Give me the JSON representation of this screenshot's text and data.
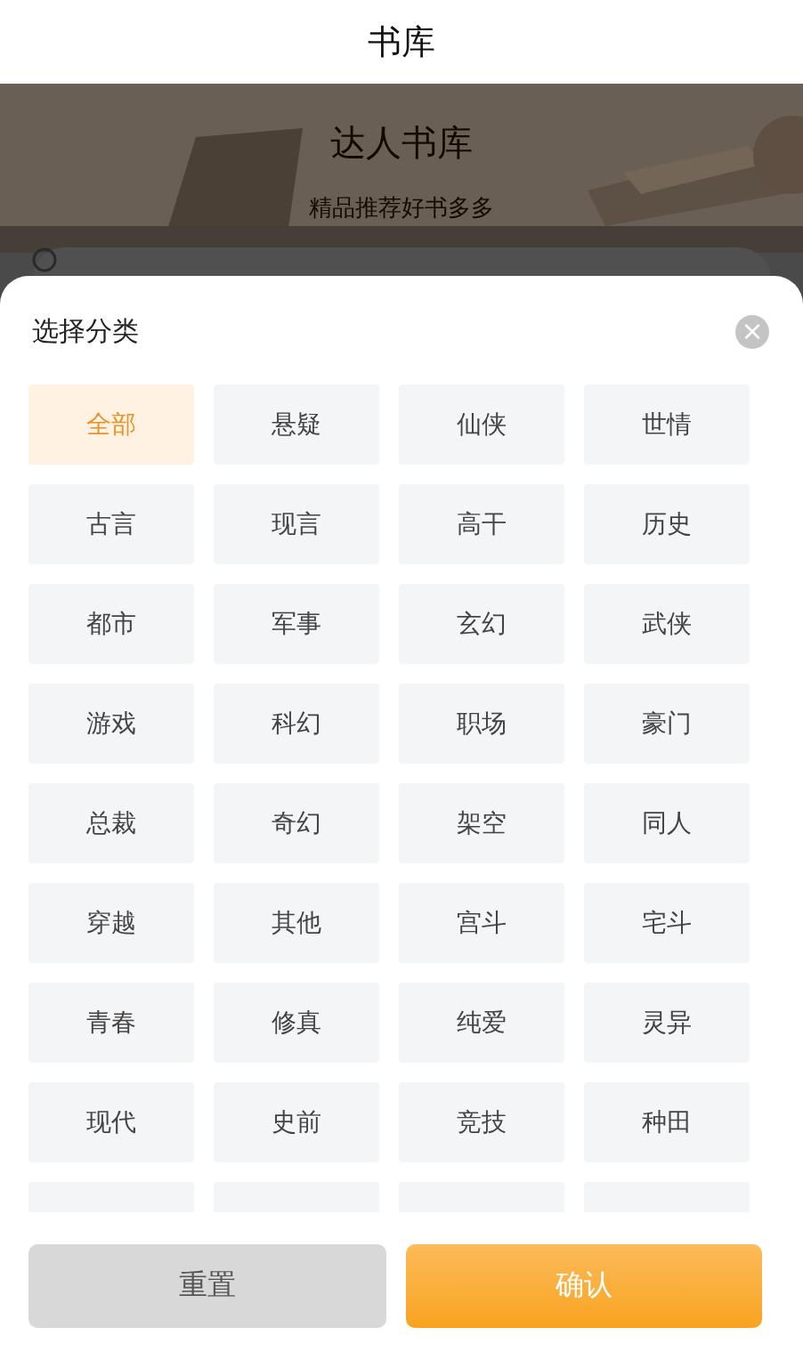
{
  "nav_bar": {
    "title": "书库"
  },
  "banner": {
    "title": "达人书库",
    "subtitle": "精品推荐好书多多"
  },
  "sheet": {
    "title": "选择分类",
    "close": "×",
    "categories": [
      {
        "label": "全部",
        "selected": true
      },
      {
        "label": "悬疑",
        "selected": false
      },
      {
        "label": "仙侠",
        "selected": false
      },
      {
        "label": "世情",
        "selected": false
      },
      {
        "label": "古言",
        "selected": false
      },
      {
        "label": "现言",
        "selected": false
      },
      {
        "label": "高干",
        "selected": false
      },
      {
        "label": "历史",
        "selected": false
      },
      {
        "label": "都市",
        "selected": false
      },
      {
        "label": "军事",
        "selected": false
      },
      {
        "label": "玄幻",
        "selected": false
      },
      {
        "label": "武侠",
        "selected": false
      },
      {
        "label": "游戏",
        "selected": false
      },
      {
        "label": "科幻",
        "selected": false
      },
      {
        "label": "职场",
        "selected": false
      },
      {
        "label": "豪门",
        "selected": false
      },
      {
        "label": "总裁",
        "selected": false
      },
      {
        "label": "奇幻",
        "selected": false
      },
      {
        "label": "架空",
        "selected": false
      },
      {
        "label": "同人",
        "selected": false
      },
      {
        "label": "穿越",
        "selected": false
      },
      {
        "label": "其他",
        "selected": false
      },
      {
        "label": "宫斗",
        "selected": false
      },
      {
        "label": "宅斗",
        "selected": false
      },
      {
        "label": "青春",
        "selected": false
      },
      {
        "label": "修真",
        "selected": false
      },
      {
        "label": "纯爱",
        "selected": false
      },
      {
        "label": "灵异",
        "selected": false
      },
      {
        "label": "现代",
        "selected": false
      },
      {
        "label": "史前",
        "selected": false
      },
      {
        "label": "竞技",
        "selected": false
      },
      {
        "label": "种田",
        "selected": false
      }
    ],
    "buttons": [
      {
        "label": "重置",
        "kind": "secondary"
      },
      {
        "label": "确认",
        "kind": "primary"
      }
    ]
  }
}
